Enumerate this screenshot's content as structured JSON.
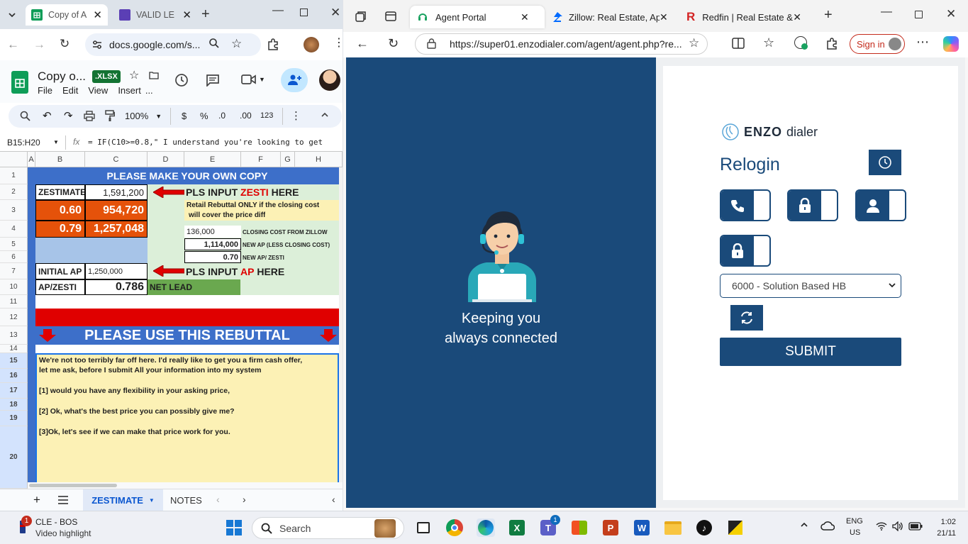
{
  "left_browser": {
    "tabs": [
      {
        "label": "Copy of A",
        "active": true
      },
      {
        "label": "VALID LE",
        "active": false
      }
    ],
    "url": "docs.google.com/s..."
  },
  "sheet": {
    "title": "Copy o...",
    "ext_badge": ".XLSX",
    "menu": [
      "File",
      "Edit",
      "View",
      "Insert",
      "..."
    ],
    "zoom": "100%",
    "toolbar_currency": "$",
    "toolbar_percent": "%",
    "toolbar_dec_less": ".0",
    "toolbar_dec_more": ".00",
    "toolbar_format": "123",
    "name_box": "B15:H20",
    "formula": "= IF(C10>=0.8,\" I understand you're looking to get",
    "columns": [
      "A",
      "B",
      "C",
      "D",
      "E",
      "F",
      "G",
      "H"
    ],
    "rows": [
      "1",
      "2",
      "3",
      "4",
      "5",
      "6",
      "7",
      "10",
      "11",
      "12",
      "13",
      "14",
      "15",
      "16",
      "17",
      "18",
      "19",
      "20"
    ],
    "cells": {
      "banner1": "PLEASE MAKE YOUR OWN COPY",
      "zestimate_label": "ZESTIMATE",
      "zestimate_value": "1,591,200",
      "input_zesti_prefix": "PLS INPUT ",
      "input_zesti_red": "ZESTI",
      "input_zesti_suffix": " HERE",
      "retail_note_1": "Retail Rebuttal ONLY if the closing cost",
      "retail_note_2": "will cover the price diff",
      "pct_1": "0.60",
      "val_1": "954,720",
      "pct_2": "0.79",
      "val_2": "1,257,048",
      "closing_cost": "136,000",
      "closing_cost_label": "CLOSING COST FROM ZILLOW",
      "new_ap": "1,114,000",
      "new_ap_label": "NEW AP (LESS CLOSING COST)",
      "new_ratio": "0.70",
      "new_ratio_label": "NEW AP/ ZESTI",
      "initial_ap_label": "INITIAL AP",
      "initial_ap_value": "1,250,000",
      "input_ap_prefix": "PLS INPUT ",
      "input_ap_red": "AP",
      "input_ap_suffix": " HERE",
      "ap_zesti_label": "AP/ZESTI",
      "ap_zesti_value": "0.786",
      "net_lead": "NET LEAD",
      "banner2": "PLEASE USE THIS REBUTTAL",
      "rebuttal_1": "We're not too terribly far off here. I'd really like to get you a firm cash offer,",
      "rebuttal_2": "let me ask, before I submit All your information into my system",
      "rebuttal_3": "[1] would you have any flexibility in your asking price,",
      "rebuttal_4": "[2] Ok, what's the best price you can possibly give me?",
      "rebuttal_5": "[3]Ok, let's see if we can make that price work for you."
    },
    "sheet_tabs": [
      "ZESTIMATE",
      "NOTES"
    ]
  },
  "right_browser": {
    "tabs": [
      {
        "label": "Agent Portal",
        "active": true
      },
      {
        "label": "Zillow: Real Estate, Apart",
        "active": false
      },
      {
        "label": "Redfin | Real Estate & Ho",
        "active": false
      }
    ],
    "url": "https://super01.enzodialer.com/agent/agent.php?re...",
    "sign_in": "Sign in"
  },
  "portal": {
    "tagline_1": "Keeping you",
    "tagline_2": "always connected",
    "brand": "ENZO",
    "brand_suffix": "dialer",
    "heading": "Relogin",
    "campaign_selected": "6000 - Solution Based HB",
    "submit": "SUBMIT"
  },
  "taskbar": {
    "weather_title": "CLE - BOS",
    "weather_sub": "Video highlight",
    "weather_badge": "1",
    "search_placeholder": "Search",
    "teams_badge": "1",
    "lang_1": "ENG",
    "lang_2": "US",
    "time": "1:02",
    "date": "21/11"
  },
  "colors": {
    "sheet_blue": "#3d6fc9",
    "sheet_orange": "#e5520a",
    "sheet_red": "#e00000",
    "sheet_green": "#6aa84f",
    "sheet_yellow": "#fcf1b5",
    "portal_blue": "#1a4a7a"
  }
}
